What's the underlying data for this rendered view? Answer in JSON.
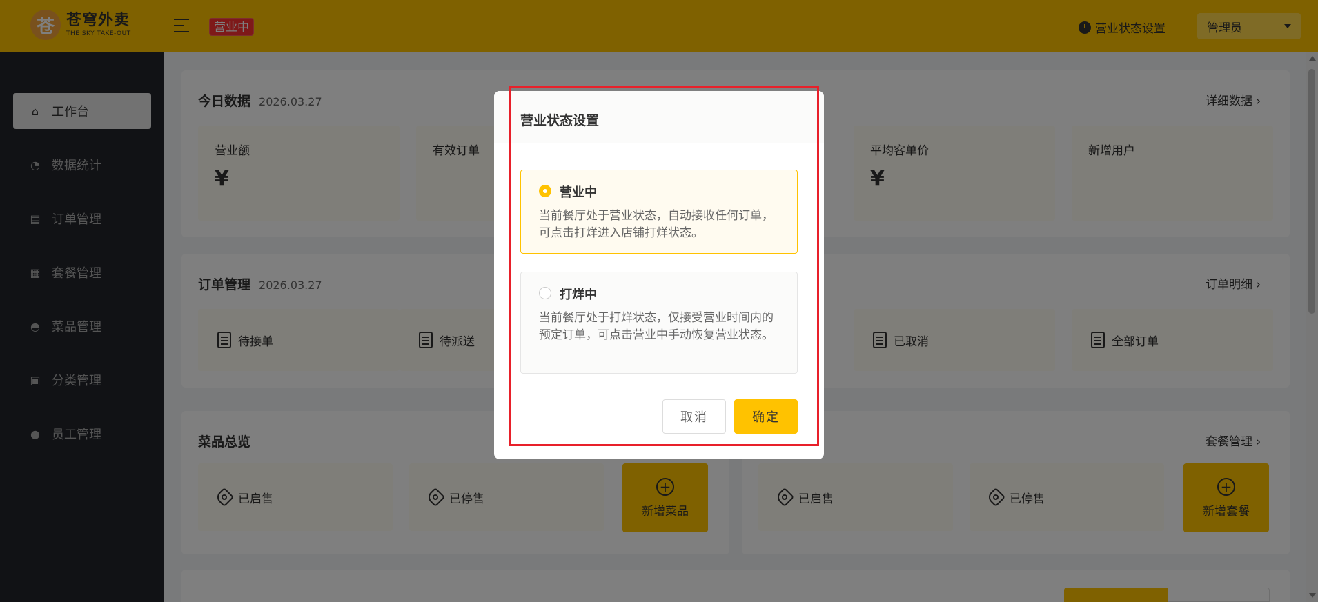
{
  "header": {
    "logo_cn": "苍穹外卖",
    "logo_en": "THE SKY TAKE-OUT",
    "status_badge": "营业中",
    "status_setting": "营业状态设置",
    "user": "管理员"
  },
  "sidebar": {
    "items": [
      {
        "label": "工作台",
        "icon": "home-icon"
      },
      {
        "label": "数据统计",
        "icon": "chart-icon"
      },
      {
        "label": "订单管理",
        "icon": "clipboard-icon"
      },
      {
        "label": "套餐管理",
        "icon": "gift-icon"
      },
      {
        "label": "菜品管理",
        "icon": "dish-cover-icon"
      },
      {
        "label": "分类管理",
        "icon": "grid-icon"
      },
      {
        "label": "员工管理",
        "icon": "employee-icon"
      }
    ]
  },
  "today": {
    "title": "今日数据",
    "date": "2026.03.27",
    "link": "详细数据",
    "metrics": [
      {
        "label": "营业额",
        "value": "¥"
      },
      {
        "label": "有效订单",
        "value": ""
      },
      {
        "label": "平均客单价",
        "value": "¥"
      },
      {
        "label": "新增用户",
        "value": ""
      }
    ]
  },
  "orders": {
    "title": "订单管理",
    "date": "2026.03.27",
    "link": "订单明细",
    "items": [
      "待接单",
      "待派送",
      "已取消",
      "全部订单"
    ]
  },
  "dishes": {
    "title": "菜品总览",
    "items": [
      "已启售",
      "已停售"
    ],
    "add": "新增菜品"
  },
  "setmeal": {
    "link": "套餐管理",
    "items": [
      "已启售",
      "已停售"
    ],
    "add": "新增套餐"
  },
  "dialog": {
    "title": "营业状态设置",
    "options": [
      {
        "title": "营业中",
        "desc": "当前餐厅处于营业状态，自动接收任何订单，可点击打烊进入店铺打烊状态。",
        "selected": true
      },
      {
        "title": "打烊中",
        "desc": "当前餐厅处于打烊状态，仅接受营业时间内的预定订单，可点击营业中手动恢复营业状态。",
        "selected": false
      }
    ],
    "cancel": "取消",
    "confirm": "确定"
  },
  "colors": {
    "accent": "#ffc200",
    "sidebar_bg": "#22252b",
    "badge_red": "#fd3333",
    "highlight_red": "#e8202a"
  }
}
